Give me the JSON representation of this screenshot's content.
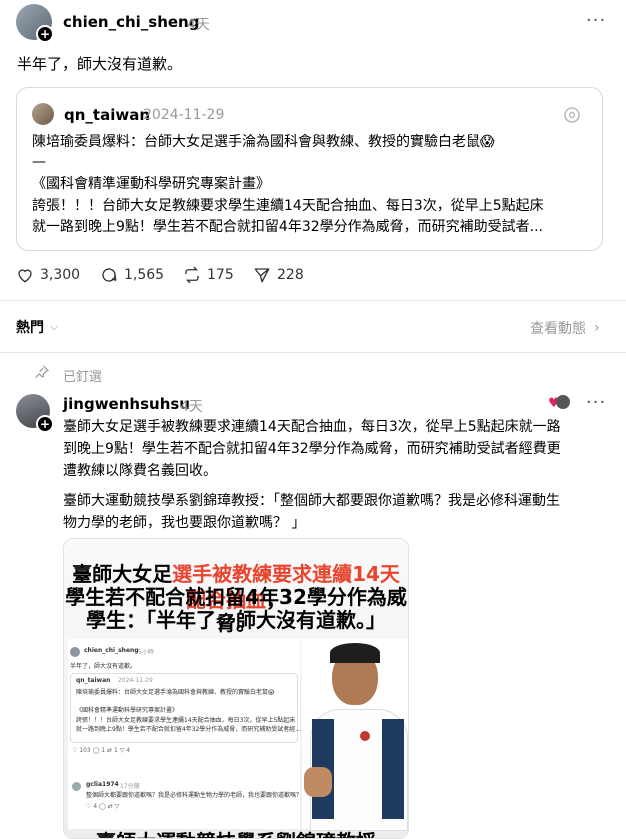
{
  "post": {
    "username": "chien_chi_sheng",
    "time": "4天",
    "text": "半年了，師大沒有道歉。",
    "quote": {
      "username": "qn_taiwan",
      "date": "2024-11-29",
      "line1": "陳培瑜委員爆料：台師大女足選手淪為國科會與教練、教授的實驗白老鼠😱",
      "line2": "—",
      "line3": "《國科會精準運動科學研究專案計畫》",
      "line4": "誇張！！！台師大女足教練要求學生連續14天配合抽血、每日3次，從早上5點起床",
      "line5": "就一路到晚上9點！學生若不配合就扣留4年32學分作為威脅，而研究補助受試者..."
    },
    "stats": {
      "likes": "3,300",
      "comments": "1,565",
      "reposts": "175",
      "shares": "228"
    }
  },
  "sort": {
    "label": "熱門",
    "activity": "查看動態"
  },
  "pinned": {
    "label": "已釘選",
    "username": "jingwenhsuhsu",
    "time": "4天",
    "para1_line1": "臺師大女足選手被教練要求連續14天配合抽血，每日3次，從早上5點起床就一路",
    "para1_line2": "到晚上9點！學生若不配合就扣留4年32學分作為威脅，而研究補助受試者經費更",
    "para1_line3": "遭教練以隊費名義回收。",
    "para2_line1": "臺師大運動競技學系劉錦璋教授：「整個師大都要跟你道歉嗎？我是必修科運動生",
    "para2_line2": "物力學的老師，我也要跟你道歉嗎？ 」"
  },
  "embed": {
    "head1_a": "臺師大女足",
    "head1_b": "選手被教練要求連續14天配合抽血",
    "head1_c": "，",
    "head2": "學生若不配合就扣留4年32學分作為威脅。",
    "head3": "學生：「半年了，師大沒有道歉。」",
    "mini_user": "chien_chi_sheng",
    "mini_time": "5小時",
    "mini_text": "半年了，師大沒有道歉。",
    "mini_quote_user": "qn_taiwan",
    "mini_quote_date": "2024-11-29",
    "mini_q1": "陳培瑜委員爆料：台師大女足選手淪為國科會與教練、教授的實驗白老鼠😱",
    "mini_q2": "《國科會精準運動科學研究專案計畫》",
    "mini_q3": "誇張！！！台師大女足教練要求學生連續14天配合抽血，每日3次，從早上5點起床",
    "mini_q4": "就一路到晚上9點！學生若不配合就扣留4年32學分作為威脅，而研究補助受試者經...",
    "mini_stats": [
      "103",
      "1",
      "1",
      "4"
    ],
    "mini_reply_user": "gclia1974",
    "mini_reply_time": "17分鐘",
    "mini_reply_text": "整個師大都要跟你道歉嗎？我是必修科運動生物力學的老師，我也要跟你道歉嗎？",
    "mini_reply_stats": [
      "4",
      "",
      "",
      ""
    ],
    "bottom_partial": "臺師大運動競技學系劉錦璋教授"
  },
  "colors": {
    "accent_red": "#e8452f",
    "heart_red": "#e0245e"
  }
}
